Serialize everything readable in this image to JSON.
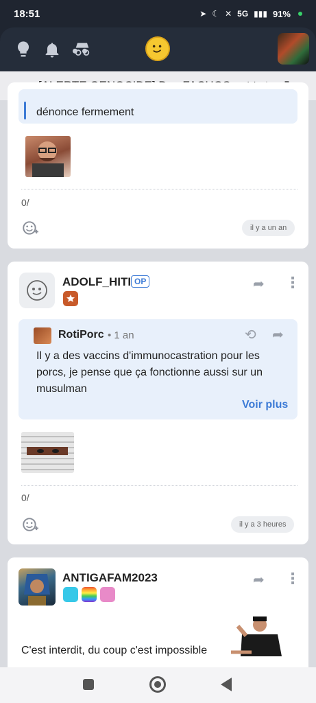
{
  "statusbar": {
    "time": "18:51",
    "net": "5G",
    "battery": "91%"
  },
  "topic": {
    "title": "[ALERTE GENOCIDE] Des FACHOS ont tro"
  },
  "posts": [
    {
      "quote_text": "dénonce fermement",
      "count": "0/",
      "time": "il y a un an"
    },
    {
      "author": "ADOLF_HITI",
      "op_label": "OP",
      "quote": {
        "author": "RotiPorc",
        "meta": "• 1 an",
        "text": "Il y a des vaccins d'immunocastration pour les porcs, je pense que ça fonctionne aussi sur un musulman",
        "more": "Voir plus"
      },
      "count": "0/",
      "time": "il y a 3 heures"
    },
    {
      "author": "ANTIGAFAM2023",
      "text": "C'est interdit, du coup c'est impossible"
    }
  ],
  "colors": {
    "accent": "#3d7bd6",
    "quote_bg": "#e8f0fb",
    "appbar": "#252d3a"
  }
}
